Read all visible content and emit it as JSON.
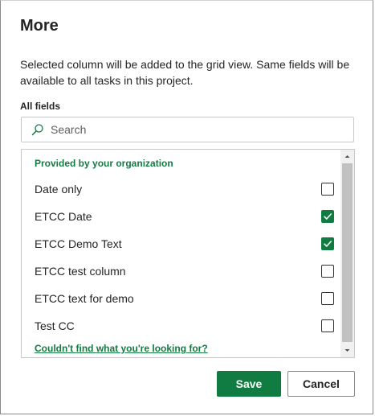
{
  "dialog": {
    "title": "More",
    "description": "Selected column will be added to the grid view. Same fields will be available to all tasks in this project.",
    "fields_label": "All fields"
  },
  "search": {
    "placeholder": "Search",
    "icon": "search-icon"
  },
  "list": {
    "group_header": "Provided by your organization",
    "items": [
      {
        "label": "Date only",
        "checked": false
      },
      {
        "label": "ETCC Date",
        "checked": true
      },
      {
        "label": "ETCC Demo Text",
        "checked": true
      },
      {
        "label": "ETCC test column",
        "checked": false
      },
      {
        "label": "ETCC text for demo",
        "checked": false
      },
      {
        "label": "Test CC",
        "checked": false
      }
    ],
    "help_link": "Couldn't find what you're looking for?"
  },
  "buttons": {
    "save": "Save",
    "cancel": "Cancel"
  },
  "colors": {
    "accent": "#107c41",
    "text": "#242424",
    "border": "#c8c8c8"
  }
}
